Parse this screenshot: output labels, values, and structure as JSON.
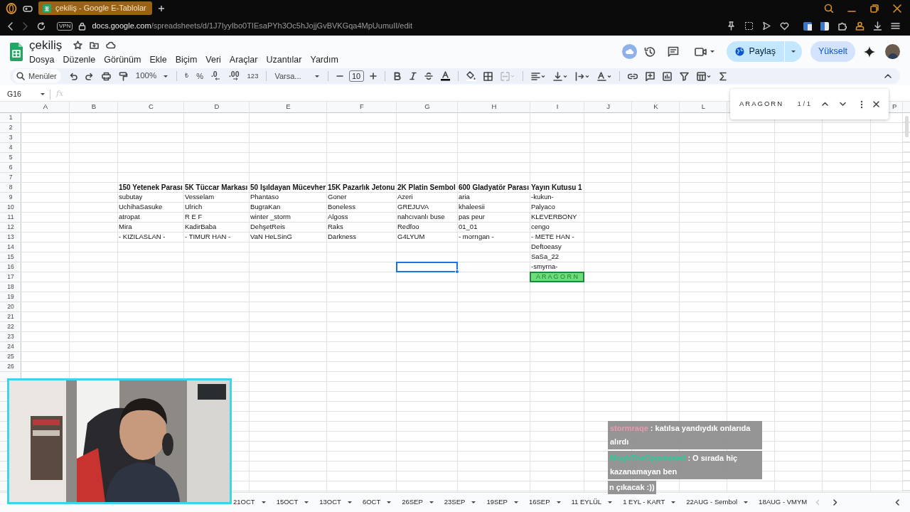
{
  "browser": {
    "tab_title": "çekiliş - Google E-Tablolar",
    "vpn_badge": "VPN",
    "url_host": "docs.google.com",
    "url_path": "/spreadsheets/d/1J7IyyIbo0TIEsaPYh3Oc5hJojjGvBVKGqa4MpUumuII/edit"
  },
  "doc": {
    "title": "çekiliş",
    "menus": [
      "Dosya",
      "Düzenle",
      "Görünüm",
      "Ekle",
      "Biçim",
      "Veri",
      "Araçlar",
      "Uzantılar",
      "Yardım"
    ],
    "share_button": "Paylaş",
    "upgrade_button": "Yükselt"
  },
  "toolbar": {
    "menus_search": "Menüler",
    "zoom": "100%",
    "currency": "₺",
    "percent": "%",
    "decrease_decimals": ".0",
    "increase_decimals": ".00",
    "number_format": "123",
    "font": "Varsa...",
    "font_size": "10"
  },
  "formula_bar": {
    "name_box": "G16",
    "fx": "fx"
  },
  "find": {
    "query": "ARAGORN",
    "count": "1 / 1"
  },
  "columns": [
    "A",
    "B",
    "C",
    "D",
    "E",
    "F",
    "G",
    "H",
    "I",
    "J",
    "K",
    "L",
    null,
    null,
    null,
    "P"
  ],
  "rows": [
    {
      "number": "1",
      "cells": {}
    },
    {
      "number": "2",
      "cells": {}
    },
    {
      "number": "3",
      "cells": {}
    },
    {
      "number": "4",
      "cells": {}
    },
    {
      "number": "5",
      "cells": {}
    },
    {
      "number": "6",
      "cells": {}
    },
    {
      "number": "7",
      "cells": {}
    },
    {
      "number": "8",
      "bold": true,
      "cells": {
        "C": {
          "text": "150 Yetenek Parası",
          "found": false,
          "selected": false
        },
        "D": {
          "text": "5K Tüccar Markası",
          "found": false,
          "selected": false
        },
        "E": {
          "text": "50 Işıldayan Mücevher",
          "found": false,
          "selected": false
        },
        "F": {
          "text": "15K Pazarlık Jetonu",
          "found": false,
          "selected": false
        },
        "G": {
          "text": "2K Platin Sembol",
          "found": false,
          "selected": false
        },
        "H": {
          "text": "600 Gladyatör Parası",
          "found": false,
          "selected": false
        },
        "I": {
          "text": "Yayın Kutusu 1",
          "found": false,
          "selected": false
        }
      }
    },
    {
      "number": "9",
      "bold": false,
      "cells": {
        "C": {
          "text": "subutay",
          "found": false,
          "selected": false
        },
        "D": {
          "text": "Vesselam",
          "found": false,
          "selected": false
        },
        "E": {
          "text": "Phantaso",
          "found": false,
          "selected": false
        },
        "F": {
          "text": "Goner",
          "found": false,
          "selected": false
        },
        "G": {
          "text": "Azeri",
          "found": false,
          "selected": false
        },
        "H": {
          "text": "aria",
          "found": false,
          "selected": false
        },
        "I": {
          "text": "-kukun-",
          "found": false,
          "selected": false
        }
      }
    },
    {
      "number": "10",
      "bold": false,
      "cells": {
        "C": {
          "text": "UchihaSasuke",
          "found": false,
          "selected": false
        },
        "D": {
          "text": "Ulrich",
          "found": false,
          "selected": false
        },
        "E": {
          "text": "BugraKan",
          "found": false,
          "selected": false
        },
        "F": {
          "text": "Boneless",
          "found": false,
          "selected": false
        },
        "G": {
          "text": "GREJUVA",
          "found": false,
          "selected": false
        },
        "H": {
          "text": "khaleesii",
          "found": false,
          "selected": false
        },
        "I": {
          "text": "Palyaco",
          "found": false,
          "selected": false
        }
      }
    },
    {
      "number": "11",
      "bold": false,
      "cells": {
        "C": {
          "text": "atropat",
          "found": false,
          "selected": false
        },
        "D": {
          "text": "R E F",
          "found": false,
          "selected": false
        },
        "E": {
          "text": "winter _storm",
          "found": false,
          "selected": false
        },
        "F": {
          "text": "Algoss",
          "found": false,
          "selected": false
        },
        "G": {
          "text": "nahcıvanlı buse",
          "found": false,
          "selected": false
        },
        "H": {
          "text": "pas peur",
          "found": false,
          "selected": false
        },
        "I": {
          "text": "KLEVERBONY",
          "found": false,
          "selected": false
        }
      }
    },
    {
      "number": "12",
      "bold": false,
      "cells": {
        "C": {
          "text": "Mira",
          "found": false,
          "selected": false
        },
        "D": {
          "text": "KadirBaba",
          "found": false,
          "selected": false
        },
        "E": {
          "text": "DehşetReis",
          "found": false,
          "selected": false
        },
        "F": {
          "text": "Raks",
          "found": false,
          "selected": false
        },
        "G": {
          "text": "Redfoo",
          "found": false,
          "selected": false
        },
        "H": {
          "text": "01_01",
          "found": false,
          "selected": false
        },
        "I": {
          "text": "cengo",
          "found": false,
          "selected": false
        }
      }
    },
    {
      "number": "13",
      "bold": false,
      "cells": {
        "C": {
          "text": "- KIZILASLAN -",
          "found": false,
          "selected": false
        },
        "D": {
          "text": "- TIMUR HAN -",
          "found": false,
          "selected": false
        },
        "E": {
          "text": "VaN HeLSinG",
          "found": false,
          "selected": false
        },
        "F": {
          "text": "Darkness",
          "found": false,
          "selected": false
        },
        "G": {
          "text": "G4LYUM",
          "found": false,
          "selected": false
        },
        "H": {
          "text": "- morrıgan -",
          "found": false,
          "selected": false
        },
        "I": {
          "text": "- METE HAN -",
          "found": false,
          "selected": false
        }
      }
    },
    {
      "number": "14",
      "bold": false,
      "cells": {
        "I": {
          "text": "Deftoeasy",
          "found": false,
          "selected": false
        }
      }
    },
    {
      "number": "15",
      "bold": false,
      "cells": {
        "I": {
          "text": "SaSa_22",
          "found": false,
          "selected": false
        }
      }
    },
    {
      "number": "16",
      "bold": false,
      "cells": {
        "G": {
          "found": false,
          "selected": true
        },
        "I": {
          "text": "-smyrna-",
          "found": false,
          "selected": false
        }
      }
    },
    {
      "number": "17",
      "bold": false,
      "cells": {
        "I": {
          "text": "A R A G O R N",
          "found": true,
          "selected": false
        }
      }
    },
    {
      "number": "18",
      "cells": {}
    },
    {
      "number": "19",
      "cells": {}
    },
    {
      "number": "20",
      "cells": {}
    },
    {
      "number": "21",
      "cells": {}
    },
    {
      "number": "22",
      "cells": {}
    },
    {
      "number": "23",
      "cells": {}
    },
    {
      "number": "24",
      "cells": {}
    },
    {
      "number": "25",
      "cells": {}
    },
    {
      "number": "26",
      "cells": {}
    }
  ],
  "sheet_tabs": [
    "21OCT",
    "15OCT",
    "13OCT",
    "6OCT",
    "26SEP",
    "23SEP",
    "19SEP",
    "16SEP",
    "11 EYLÜL",
    "1 EYL - KART",
    "22AUG - Sembol",
    "18AUG - VMYM"
  ],
  "chat": [
    {
      "user": "stormraqe",
      "color": "#e89ab0",
      "text": ": katılsa yandıydık onlarıda alırdı"
    },
    {
      "user": "MoghTheOppressed",
      "color": "#2ec99a",
      "text": ": O sırada hiç kazanamayan ben"
    },
    {
      "text": "n çıkacak :))"
    }
  ]
}
